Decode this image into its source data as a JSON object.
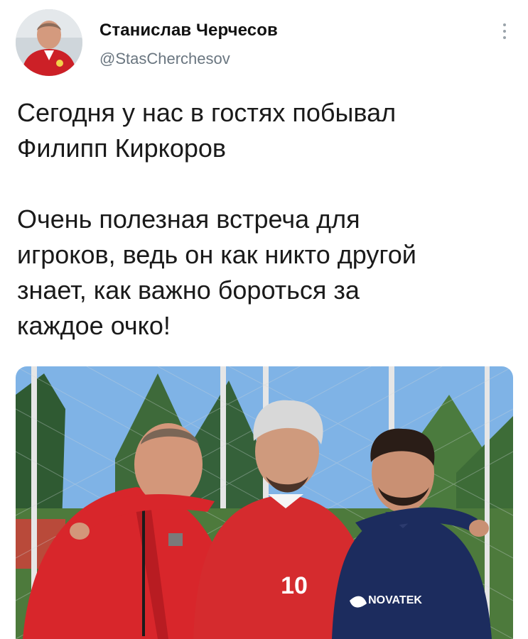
{
  "tweet": {
    "author": {
      "display_name": "Станислав Черчесов",
      "handle": "@StasCherchesov"
    },
    "text_paragraphs": [
      [
        "Сегодня у нас в гостях побывал",
        "Филипп Киркоров"
      ],
      [
        "Очень полезная встреча для",
        "игроков, ведь он как никто другой",
        "знает, как важно бороться за",
        "каждое очко!"
      ]
    ],
    "photo": {
      "jersey_number": "10",
      "shirt_sponsor": "NOVATEK"
    }
  },
  "icons": {
    "more": "vertical-ellipsis-icon"
  },
  "colors": {
    "name": "#111111",
    "handle": "#6a7680",
    "text": "#1a1a1a",
    "sky": "#7fb3e6",
    "red_kit": "#d8262b",
    "navy_kit": "#1c2c5e"
  }
}
